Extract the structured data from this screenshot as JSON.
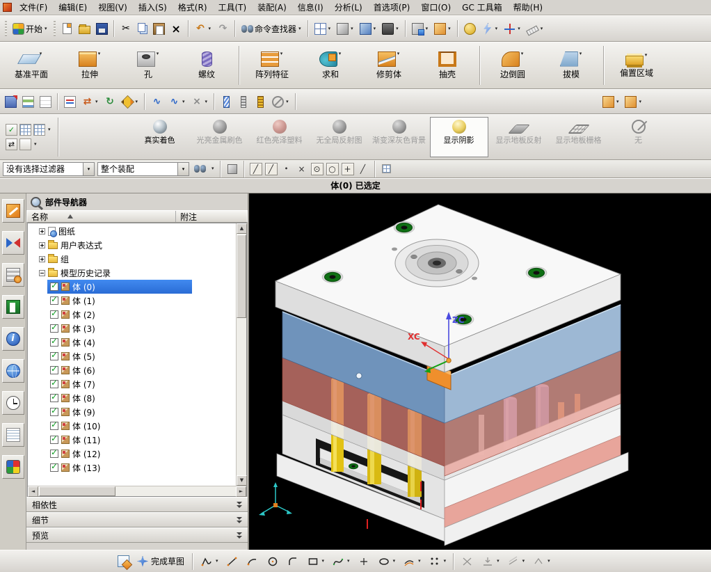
{
  "colors": {
    "selection_blue": "#2a6cd5",
    "viewport_background": "#000000",
    "top_plate_white": "#f8f8f8",
    "a_plate_blue": "#6f93bb",
    "b_plate_pink": "#d98076",
    "pillar_yellow": "#e2c214",
    "pillar_purple": "#8279b8",
    "clamp_orange": "#ef8f2c",
    "ring_green": "#0f6f14",
    "axis_zc_blue": "#4a4ae0",
    "axis_xc_red": "#e03030"
  },
  "glyphs": {
    "dropdown": "▾",
    "sort_ascending": "▲",
    "scroll_up": "▲",
    "scroll_down": "▼",
    "scroll_left": "◄",
    "scroll_right": "►",
    "check": "✓",
    "cut": "✂",
    "delete": "×",
    "undo": "↶",
    "redo": "↷",
    "swap": "⇄",
    "rotate": "↻",
    "snap_line": "╱",
    "snap_center": "⊙",
    "snap_circle": "○",
    "snap_point": "+",
    "snap_intersection": "×",
    "snap_dot": "∙",
    "curve": "∿",
    "info": "i"
  },
  "menubar": {
    "items": [
      "文件(F)",
      "编辑(E)",
      "视图(V)",
      "插入(S)",
      "格式(R)",
      "工具(T)",
      "装配(A)",
      "信息(I)",
      "分析(L)",
      "首选项(P)",
      "窗口(O)",
      "GC 工具箱",
      "帮助(H)"
    ]
  },
  "toolbar_standard": {
    "start_label": "开始",
    "command_finder_label": "命令查找器"
  },
  "feature_toolbar": {
    "buttons": [
      {
        "label": "基准平面"
      },
      {
        "label": "拉伸"
      },
      {
        "label": "孔"
      },
      {
        "label": "螺纹"
      },
      {
        "label": "阵列特征"
      },
      {
        "label": "求和"
      },
      {
        "label": "修剪体"
      },
      {
        "label": "抽壳"
      },
      {
        "label": "边倒圆"
      },
      {
        "label": "拔模"
      },
      {
        "label": "偏置区域"
      }
    ]
  },
  "render_toolbar": {
    "buttons": [
      {
        "label": "真实着色",
        "state": "normal"
      },
      {
        "label": "光亮金属刷色",
        "state": "disabled"
      },
      {
        "label": "红色亮泽塑料",
        "state": "disabled"
      },
      {
        "label": "无全局反射图",
        "state": "disabled"
      },
      {
        "label": "渐变深灰色背景",
        "state": "disabled"
      },
      {
        "label": "显示阴影",
        "state": "selected"
      },
      {
        "label": "显示地板反射",
        "state": "disabled"
      },
      {
        "label": "显示地板栅格",
        "state": "disabled"
      },
      {
        "label": "无",
        "state": "disabled"
      }
    ]
  },
  "selection_bar": {
    "filter_value": "没有选择过滤器",
    "scope_value": "整个装配"
  },
  "status_bar": {
    "text": "体(0) 已选定"
  },
  "navigator": {
    "title": "部件导航器",
    "columns": {
      "name": "名称",
      "note": "附注"
    },
    "folders": [
      {
        "label": "图纸"
      },
      {
        "label": "用户表达式"
      },
      {
        "label": "组"
      },
      {
        "label": "模型历史记录",
        "expanded": true
      }
    ],
    "bodies": [
      {
        "label": "体 (0)",
        "selected": true
      },
      {
        "label": "体 (1)"
      },
      {
        "label": "体 (2)"
      },
      {
        "label": "体 (3)"
      },
      {
        "label": "体 (4)"
      },
      {
        "label": "体 (5)"
      },
      {
        "label": "体 (6)"
      },
      {
        "label": "体 (7)"
      },
      {
        "label": "体 (8)"
      },
      {
        "label": "体 (9)"
      },
      {
        "label": "体 (10)"
      },
      {
        "label": "体 (11)"
      },
      {
        "label": "体 (12)"
      },
      {
        "label": "体 (13)"
      }
    ],
    "sections": [
      "相依性",
      "细节",
      "预览"
    ]
  },
  "viewport": {
    "axis_labels": {
      "zc": "ZC",
      "xc": "XC"
    }
  },
  "bottom_toolbar": {
    "finish_sketch_label": "完成草图"
  }
}
